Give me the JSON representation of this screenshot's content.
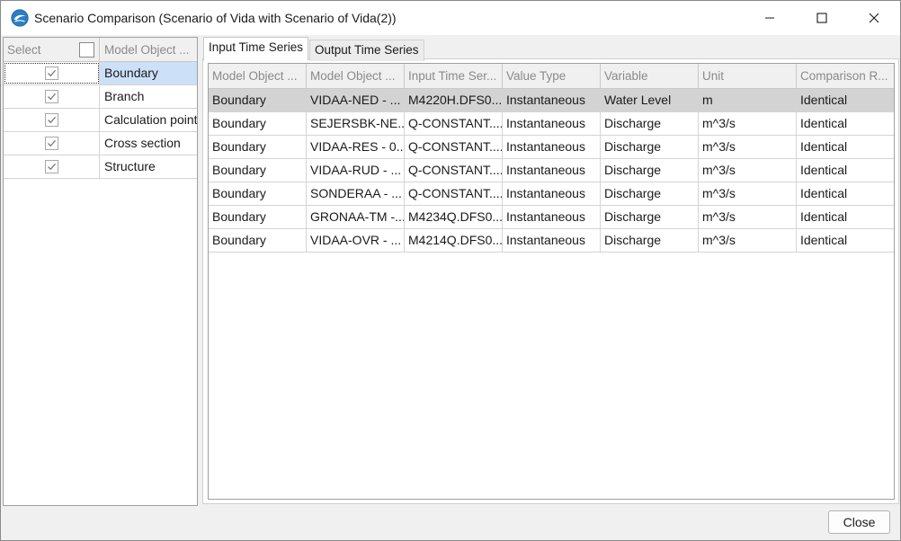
{
  "window": {
    "title": "Scenario Comparison (Scenario of Vida with Scenario of Vida(2))",
    "app_icon": "mike-app-icon",
    "controls": {
      "minimize": "minimize-icon",
      "maximize": "maximize-icon",
      "close": "close-icon"
    }
  },
  "left_panel": {
    "headers": {
      "select": "Select",
      "model_object": "Model Object ..."
    },
    "select_all_checked": false,
    "items": [
      {
        "label": "Boundary",
        "checked": true
      },
      {
        "label": "Branch",
        "checked": true
      },
      {
        "label": "Calculation point",
        "checked": true
      },
      {
        "label": "Cross section",
        "checked": true
      },
      {
        "label": "Structure",
        "checked": true
      }
    ]
  },
  "tabs": [
    {
      "label": "Input Time Series",
      "active": true
    },
    {
      "label": "Output Time Series",
      "active": false
    }
  ],
  "grid": {
    "columns": [
      "Model Object ...",
      "Model Object ...",
      "Input Time Ser...",
      "Value Type",
      "Variable",
      "Unit",
      "Comparison R..."
    ],
    "rows": [
      [
        "Boundary",
        "VIDAA-NED - ...",
        "M4220H.DFS0...",
        "Instantaneous",
        "Water Level",
        "m",
        "Identical"
      ],
      [
        "Boundary",
        "SEJERSBK-NE...",
        "Q-CONSTANT....",
        "Instantaneous",
        "Discharge",
        "m^3/s",
        "Identical"
      ],
      [
        "Boundary",
        "VIDAA-RES - 0...",
        "Q-CONSTANT....",
        "Instantaneous",
        "Discharge",
        "m^3/s",
        "Identical"
      ],
      [
        "Boundary",
        "VIDAA-RUD - ...",
        "Q-CONSTANT....",
        "Instantaneous",
        "Discharge",
        "m^3/s",
        "Identical"
      ],
      [
        "Boundary",
        "SONDERAA - ...",
        "Q-CONSTANT....",
        "Instantaneous",
        "Discharge",
        "m^3/s",
        "Identical"
      ],
      [
        "Boundary",
        "GRONAA-TM -...",
        "M4234Q.DFS0...",
        "Instantaneous",
        "Discharge",
        "m^3/s",
        "Identical"
      ],
      [
        "Boundary",
        "VIDAA-OVR - ...",
        "M4214Q.DFS0...",
        "Instantaneous",
        "Discharge",
        "m^3/s",
        "Identical"
      ]
    ]
  },
  "footer": {
    "close_label": "Close"
  },
  "colors": {
    "selection_left": "#cce0f7",
    "selection_grid": "#d3d3d3",
    "header_text": "#8a8a8a"
  }
}
